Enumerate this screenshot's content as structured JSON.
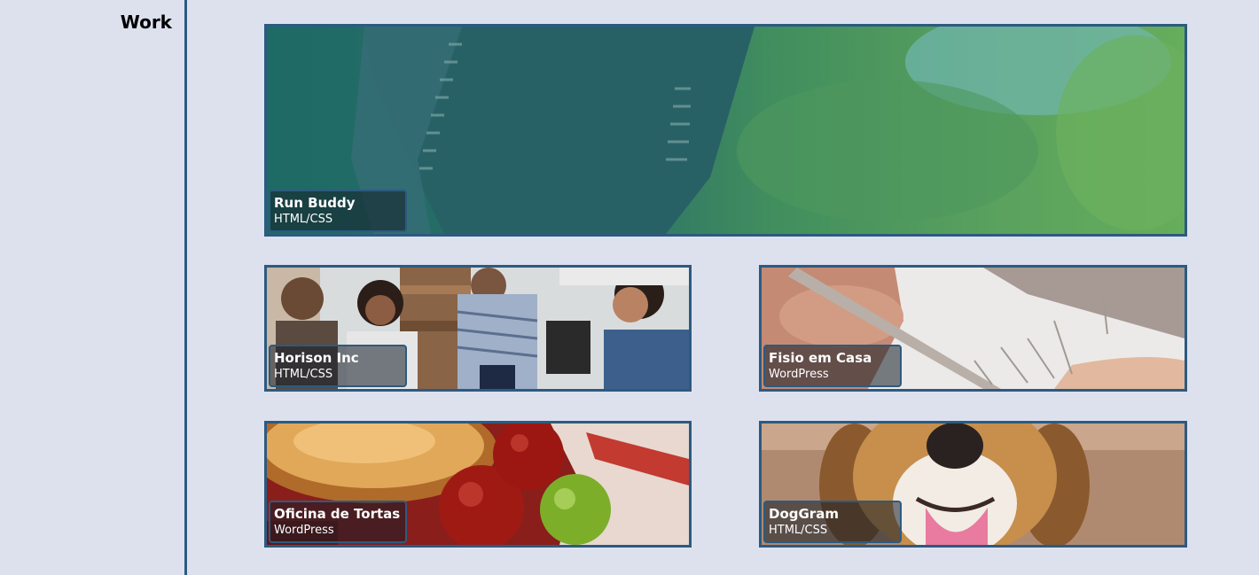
{
  "section": {
    "title": "Work"
  },
  "projects": [
    {
      "name": "Run Buddy",
      "tech": "HTML/CSS",
      "image": "runner-photo"
    },
    {
      "name": "Horison Inc",
      "tech": "HTML/CSS",
      "image": "team-meeting-photo"
    },
    {
      "name": "Fisio em Casa",
      "tech": "WordPress",
      "image": "acupuncture-photo"
    },
    {
      "name": "Oficina de Tortas",
      "tech": "WordPress",
      "image": "pie-and-apples-photo"
    },
    {
      "name": "DogGram",
      "tech": "HTML/CSS",
      "image": "beagle-photo"
    }
  ],
  "colors": {
    "background": "#dde1ee",
    "accent": "#2d5a80"
  }
}
